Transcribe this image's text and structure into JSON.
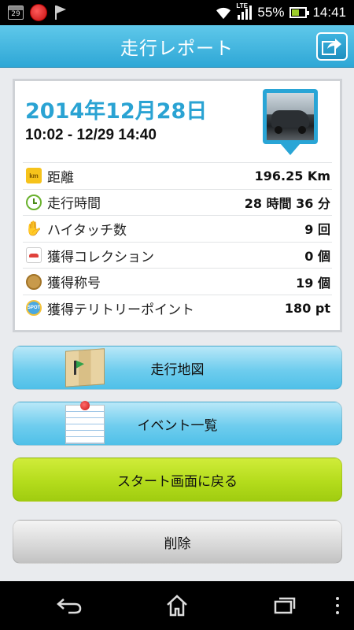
{
  "status_bar": {
    "calendar_day": "29",
    "battery_percent": "55%",
    "battery_level": 0.55,
    "network": "LTE",
    "time": "14:41"
  },
  "header": {
    "title": "走行レポート",
    "share_icon": "share-arrow-icon"
  },
  "report": {
    "date": "2014年12月28日",
    "time_range": "10:02 - 12/29 14:40",
    "photo_icon": "car-photo-icon",
    "stats": [
      {
        "icon": "km-icon",
        "icon_text": "km",
        "label": "距離",
        "value": "196.25 Km"
      },
      {
        "icon": "clock-icon",
        "label": "走行時間",
        "value": "28 時間 36 分"
      },
      {
        "icon": "hand-icon",
        "label": "ハイタッチ数",
        "value": "9 回"
      },
      {
        "icon": "car-icon",
        "label": "獲得コレクション",
        "value": "0 個"
      },
      {
        "icon": "medal-icon",
        "label": "獲得称号",
        "value": "19 個"
      },
      {
        "icon": "spot-icon",
        "icon_text": "SPOT",
        "label": "獲得テリトリーポイント",
        "value": "180 pt"
      }
    ]
  },
  "buttons": {
    "map": "走行地図",
    "events": "イベント一覧",
    "back_to_start": "スタート画面に戻る",
    "delete": "削除"
  },
  "colors": {
    "header_blue": "#2ea7d6",
    "date_blue": "#2aa3d3",
    "button_blue": "#6fcdee",
    "button_green": "#b4dc1c",
    "button_gray": "#d7d7d7"
  }
}
